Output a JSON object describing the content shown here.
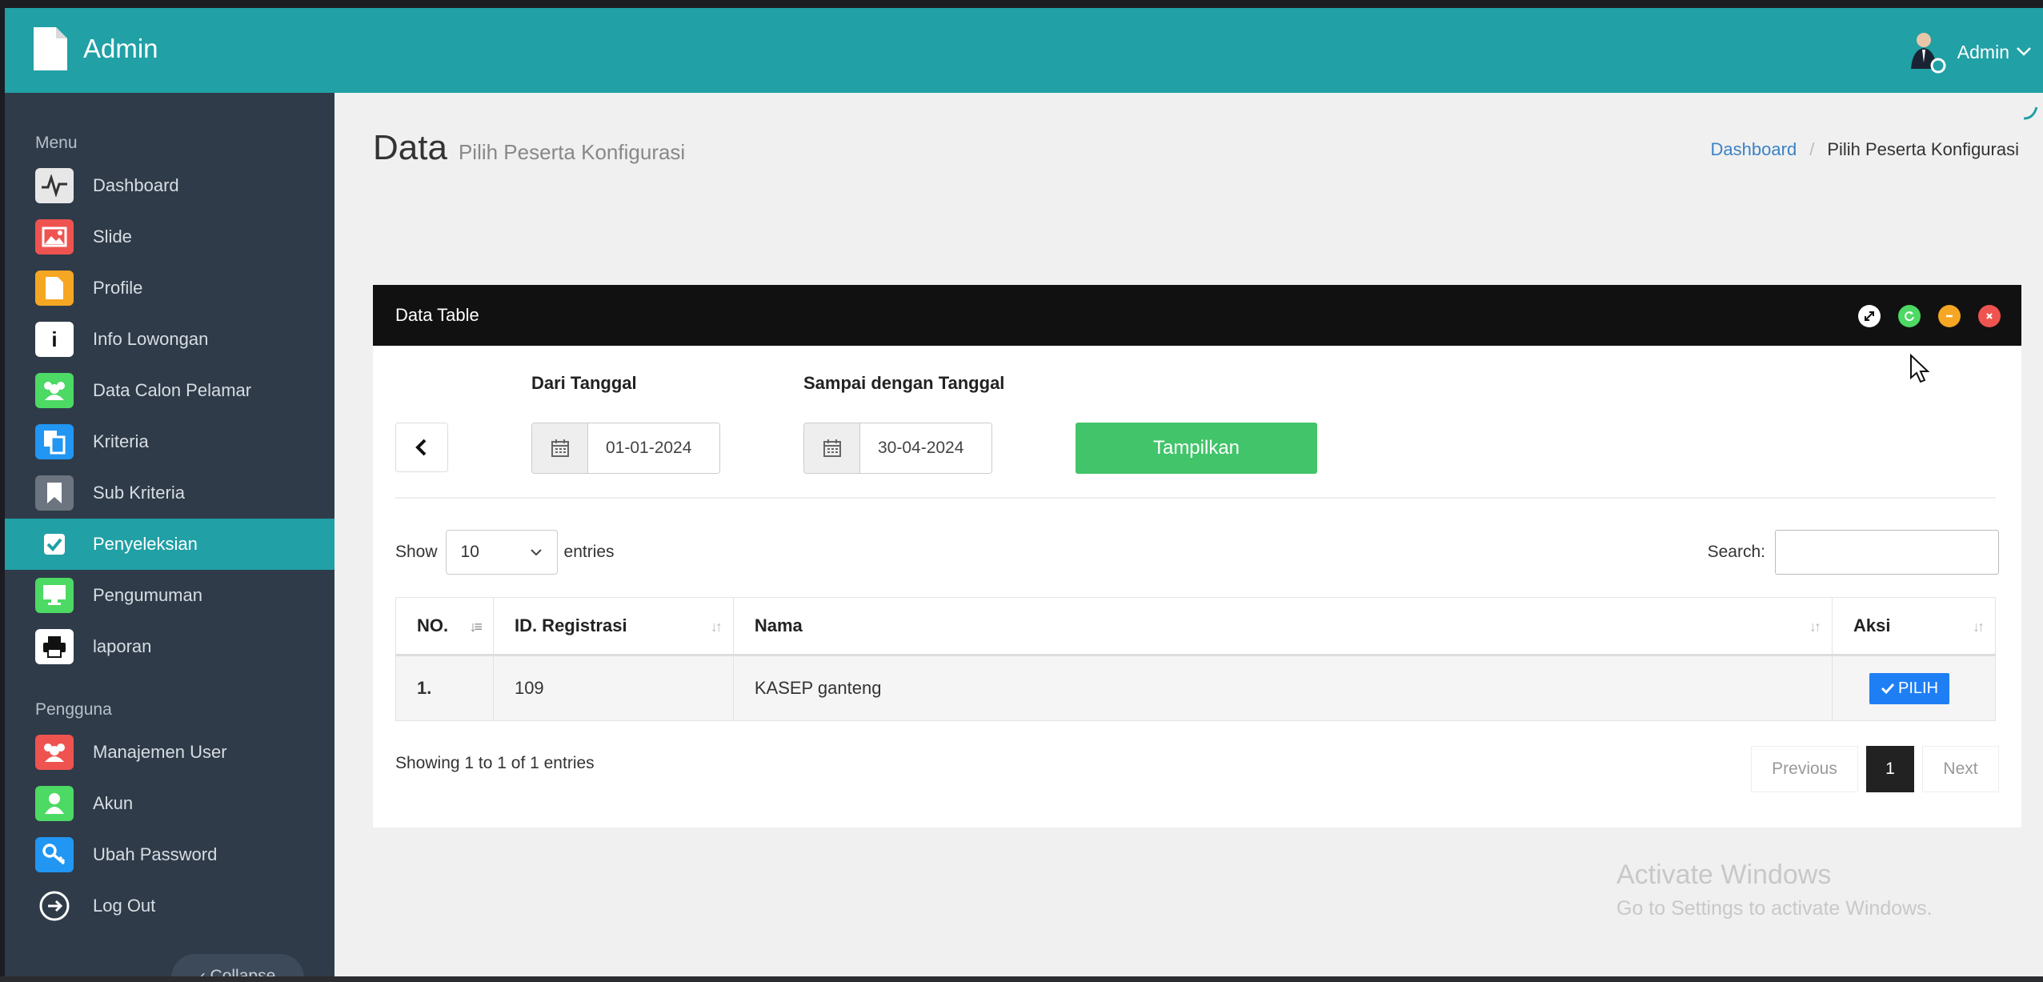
{
  "app": {
    "brand": "Admin",
    "user_name": "Admin"
  },
  "sidebar": {
    "menu_header": "Menu",
    "items": [
      {
        "label": "Dashboard",
        "icon": "pulse-icon",
        "color": "#e7e7e7"
      },
      {
        "label": "Slide",
        "icon": "image-icon",
        "color": "#ef5350"
      },
      {
        "label": "Profile",
        "icon": "file-icon",
        "color": "#f5a623"
      },
      {
        "label": "Info Lowongan",
        "icon": "info-icon",
        "color": "#ffffff"
      },
      {
        "label": "Data Calon Pelamar",
        "icon": "users-icon",
        "color": "#4cd964"
      },
      {
        "label": "Kriteria",
        "icon": "copy-icon",
        "color": "#2196f3"
      },
      {
        "label": "Sub Kriteria",
        "icon": "bookmark-icon",
        "color": "#6c7480"
      },
      {
        "label": "Penyeleksian",
        "icon": "checkbox-icon",
        "color": "#21a0a5"
      },
      {
        "label": "Pengumuman",
        "icon": "monitor-icon",
        "color": "#4cd964"
      },
      {
        "label": "laporan",
        "icon": "printer-icon",
        "color": "#ffffff"
      }
    ],
    "pengguna_header": "Pengguna",
    "pengguna_items": [
      {
        "label": "Manajemen User",
        "icon": "users-icon",
        "color": "#ef5350"
      },
      {
        "label": "Akun",
        "icon": "user-icon",
        "color": "#4cd964"
      },
      {
        "label": "Ubah Password",
        "icon": "key-icon",
        "color": "#2196f3"
      },
      {
        "label": "Log Out",
        "icon": "logout-icon",
        "color": "#ffffff"
      }
    ],
    "collapse_label": "Collapse"
  },
  "page": {
    "title": "Data",
    "subtitle": "Pilih Peserta Konfigurasi",
    "breadcrumb_home": "Dashboard",
    "breadcrumb_current": "Pilih Peserta Konfigurasi"
  },
  "panel": {
    "title": "Data Table",
    "from_label": "Dari Tanggal",
    "from_value": "01-01-2024",
    "to_label": "Sampai dengan Tanggal",
    "to_value": "30-04-2024",
    "show_button": "Tampilkan",
    "show_label": "Show",
    "entries_value": "10",
    "entries_label": "entries",
    "search_label": "Search:",
    "columns": [
      "NO.",
      "ID. Registrasi",
      "Nama",
      "Aksi"
    ],
    "rows": [
      {
        "no": "1.",
        "id": "109",
        "nama": "KASEP ganteng",
        "aksi": "PILIH"
      }
    ],
    "info": "Showing 1 to 1 of 1 entries",
    "pager": {
      "prev": "Previous",
      "current": "1",
      "next": "Next"
    }
  },
  "watermark": {
    "line1": "Activate Windows",
    "line2": "Go to Settings to activate Windows."
  }
}
